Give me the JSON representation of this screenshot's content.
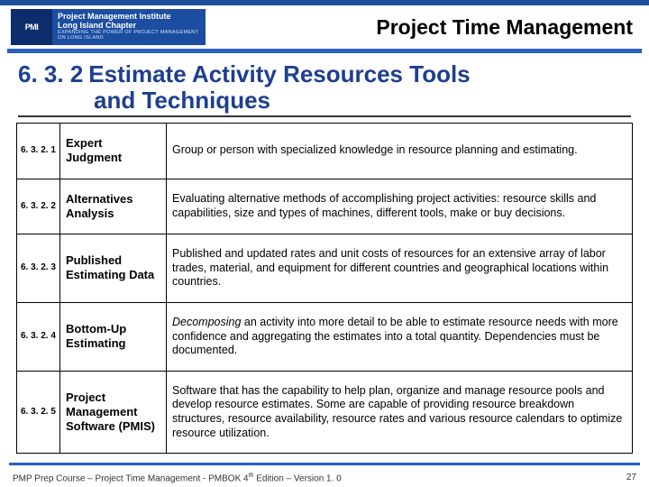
{
  "header": {
    "logo": {
      "short": "PMI",
      "line1": "Project Management Institute",
      "line2": "Long Island Chapter",
      "tag": "EXPANDING THE POWER OF PROJECT MANAGEMENT ON LONG ISLAND"
    },
    "title": "Project Time Management"
  },
  "section": {
    "number": "6. 3. 2",
    "title_line1": "Estimate Activity Resources Tools",
    "title_line2": "and Techniques"
  },
  "rows": [
    {
      "num": "6. 3. 2. 1",
      "name": "Expert Judgment",
      "desc": "Group or person with specialized knowledge in resource planning and estimating."
    },
    {
      "num": "6. 3. 2. 2",
      "name": "Alternatives Analysis",
      "desc": "Evaluating alternative methods of accomplishing project activities: resource skills and capabilities, size and types of machines, different tools, make or buy decisions."
    },
    {
      "num": "6. 3. 2. 3",
      "name": "Published Estimating Data",
      "desc": "Published and updated rates and unit costs of resources for an extensive array of labor trades, material, and equipment for different countries and geographical locations within countries."
    },
    {
      "num": "6. 3. 2. 4",
      "name": "Bottom-Up Estimating",
      "desc_html": "<em>Decomposing</em> an activity into more detail to be able to estimate resource needs with more confidence and aggregating the estimates into a total quantity. Dependencies must be documented."
    },
    {
      "num": "6. 3. 2. 5",
      "name": "Project Management Software (PMIS)",
      "desc": "Software that has the capability to help plan, organize and manage resource pools and develop resource estimates. Some are capable of providing resource breakdown structures, resource availability, resource rates and various resource calendars to optimize resource utilization."
    }
  ],
  "footer": {
    "left_html": "PMP Prep Course – Project Time Management - PMBOK 4<sup>th</sup> Edition – Version 1. 0",
    "page": "27"
  }
}
